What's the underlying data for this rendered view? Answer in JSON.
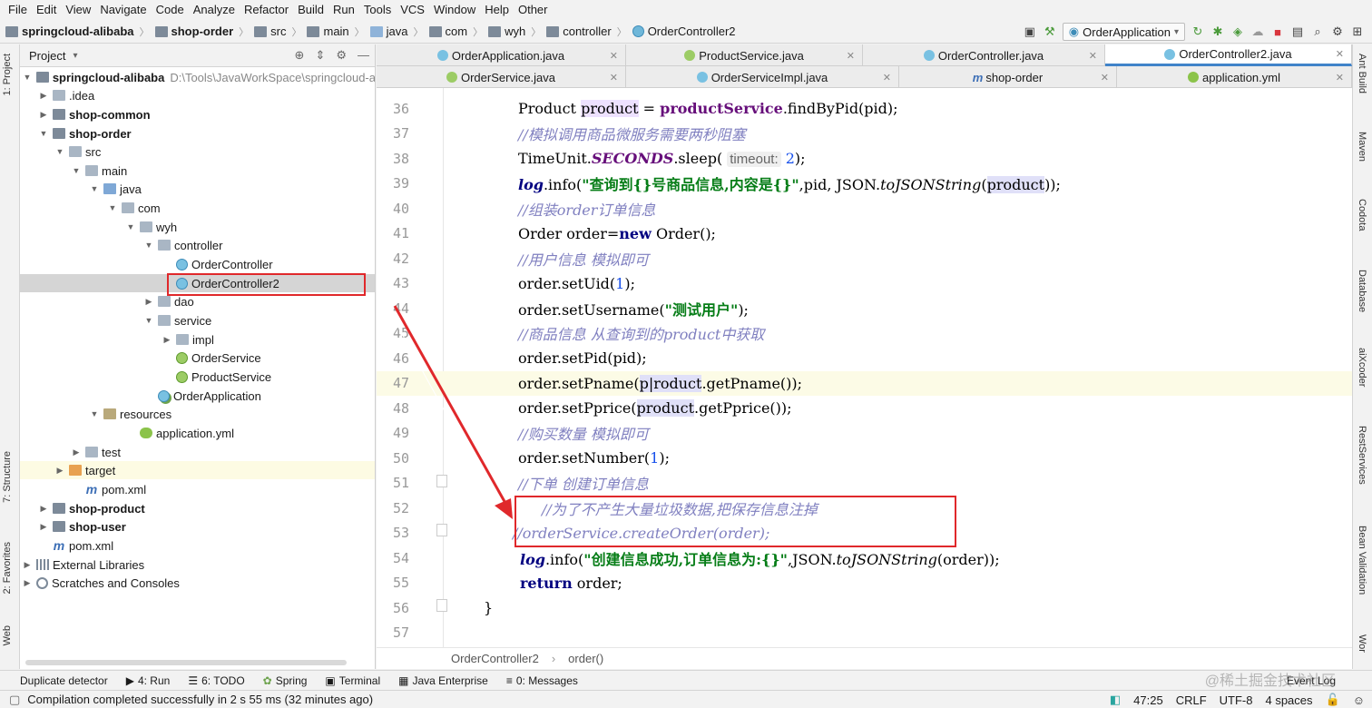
{
  "menu": [
    "File",
    "Edit",
    "View",
    "Navigate",
    "Code",
    "Analyze",
    "Refactor",
    "Build",
    "Run",
    "Tools",
    "VCS",
    "Window",
    "Help",
    "Other"
  ],
  "breadcrumbs": [
    "springcloud-alibaba",
    "shop-order",
    "src",
    "main",
    "java",
    "com",
    "wyh",
    "controller",
    "OrderController2"
  ],
  "run_config": "OrderApplication",
  "project_panel": {
    "title": "Project",
    "tree": [
      {
        "label": "springcloud-alibaba",
        "hint": "D:\\Tools\\JavaWorkSpace\\springcloud-a"
      },
      {
        "label": ".idea"
      },
      {
        "label": "shop-common"
      },
      {
        "label": "shop-order"
      },
      {
        "label": "src"
      },
      {
        "label": "main"
      },
      {
        "label": "java"
      },
      {
        "label": "com"
      },
      {
        "label": "wyh"
      },
      {
        "label": "controller"
      },
      {
        "label": "OrderController"
      },
      {
        "label": "OrderController2"
      },
      {
        "label": "dao"
      },
      {
        "label": "service"
      },
      {
        "label": "impl"
      },
      {
        "label": "OrderService"
      },
      {
        "label": "ProductService"
      },
      {
        "label": "OrderApplication"
      },
      {
        "label": "resources"
      },
      {
        "label": "application.yml"
      },
      {
        "label": "test"
      },
      {
        "label": "target"
      },
      {
        "label": "pom.xml"
      },
      {
        "label": "shop-product"
      },
      {
        "label": "shop-user"
      },
      {
        "label": "pom.xml"
      },
      {
        "label": "External Libraries"
      },
      {
        "label": "Scratches and Consoles"
      }
    ]
  },
  "left_tabs": [
    "1: Project",
    "7: Structure",
    "2: Favorites",
    "Web"
  ],
  "right_tabs": [
    "Ant Build",
    "Maven",
    "Codota",
    "Database",
    "aiXcoder",
    "RestServices",
    "Bean Validation",
    "Wor"
  ],
  "tabs_row1": [
    "OrderApplication.java",
    "ProductService.java",
    "OrderController.java",
    "OrderController2.java"
  ],
  "tabs_row2": [
    "OrderService.java",
    "OrderServiceImpl.java",
    "shop-order",
    "application.yml"
  ],
  "editor": {
    "lines": [
      {
        "n": "36",
        "text": "Product product = productService.findByPid(pid);"
      },
      {
        "n": "37",
        "text": "//模拟调用商品微服务需要两秒阻塞"
      },
      {
        "n": "38",
        "text": "TimeUnit.SECONDS.sleep( timeout: 2);"
      },
      {
        "n": "39",
        "text": "log.info(\"查询到{}号商品信息,内容是{}\",pid, JSON.toJSONString(product));"
      },
      {
        "n": "40",
        "text": "//组装order订单信息"
      },
      {
        "n": "41",
        "text": "Order order=new Order();"
      },
      {
        "n": "42",
        "text": "//用户信息 模拟即可"
      },
      {
        "n": "43",
        "text": "order.setUid(1);"
      },
      {
        "n": "44",
        "text": "order.setUsername(\"测试用户\");"
      },
      {
        "n": "45",
        "text": "//商品信息 从查询到的product中获取"
      },
      {
        "n": "46",
        "text": "order.setPid(pid);"
      },
      {
        "n": "47",
        "text": "order.setPname(product.getPname());"
      },
      {
        "n": "48",
        "text": "order.setPprice(product.getPprice());"
      },
      {
        "n": "49",
        "text": "//购买数量 模拟即可"
      },
      {
        "n": "50",
        "text": "order.setNumber(1);"
      },
      {
        "n": "51",
        "text": "//下单 创建订单信息"
      },
      {
        "n": "52",
        "text": "//为了不产生大量垃圾数据,把保存信息注掉"
      },
      {
        "n": "53",
        "text": "//orderService.createOrder(order);"
      },
      {
        "n": "54",
        "text": "log.info(\"创建信息成功,订单信息为:{}\",JSON.toJSONString(order));"
      },
      {
        "n": "55",
        "text": "return order;"
      },
      {
        "n": "56",
        "text": "}"
      },
      {
        "n": "57",
        "text": ""
      }
    ],
    "breadcrumb": [
      "OrderController2",
      "order()"
    ]
  },
  "bottom_tools": [
    "Duplicate detector",
    "4: Run",
    "6: TODO",
    "Spring",
    "Terminal",
    "Java Enterprise",
    "0: Messages",
    "Event Log"
  ],
  "status": {
    "message": "Compilation completed successfully in 2 s 55 ms (32 minutes ago)",
    "position": "47:25",
    "line_sep": "CRLF",
    "encoding": "UTF-8",
    "indent": "4 spaces"
  },
  "watermark": "@稀土掘金技术社区",
  "colors": {
    "accent": "#4083c9",
    "highlight_box": "#e0282b",
    "comment": "#8080c0",
    "string": "#067d17",
    "keyword": "#000080"
  }
}
